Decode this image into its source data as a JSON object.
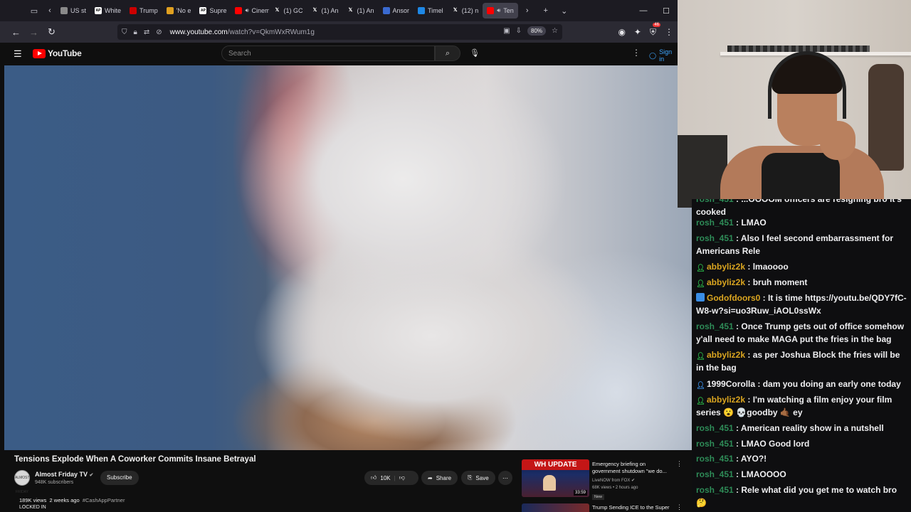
{
  "browser": {
    "tabs": [
      {
        "label": "US st",
        "icon": "doc-icon",
        "color": "#8a8a8a"
      },
      {
        "label": "White",
        "icon": "ap-icon",
        "color": "#ffffff"
      },
      {
        "label": "Trump",
        "icon": "cnn-icon",
        "color": "#cc0000"
      },
      {
        "label": "'No e",
        "icon": "nbc-icon",
        "color": "#e0a020"
      },
      {
        "label": "Supre",
        "icon": "ap-icon",
        "color": "#ffffff"
      },
      {
        "label": "Cinem",
        "icon": "youtube-icon",
        "color": "#ff0000"
      },
      {
        "label": "(1) GC",
        "icon": "x-icon",
        "color": "#ffffff"
      },
      {
        "label": "(1) An",
        "icon": "x-icon",
        "color": "#ffffff"
      },
      {
        "label": "(1) An",
        "icon": "x-icon",
        "color": "#ffffff"
      },
      {
        "label": "Ansor",
        "icon": "site-icon",
        "color": "#3a6ad0"
      },
      {
        "label": "Timel",
        "icon": "globe-icon",
        "color": "#1e88e5"
      },
      {
        "label": "(12) n",
        "icon": "x-icon",
        "color": "#ffffff"
      },
      {
        "label": "Ten",
        "icon": "youtube-icon",
        "color": "#ff0000"
      }
    ],
    "url_host": "www.youtube.com",
    "url_path": "/watch?v=QkmWxRWum1g",
    "zoom": "80%",
    "extension_badge": "46"
  },
  "youtube": {
    "logo_text": "YouTube",
    "search_placeholder": "Search",
    "sign_in": "Sign in",
    "video_title": "Tensions Explode When A Coworker Commits Insane Betrayal",
    "channel_name": "Almost Friday TV",
    "channel_avatar": "ALMOST FRIDAY",
    "subscribers": "948K subscribers",
    "subscribe_label": "Subscribe",
    "likes": "10K",
    "share_label": "Share",
    "save_label": "Save",
    "views": "189K views",
    "age": "2 weeks ago",
    "hashtag": "#CashAppPartner",
    "locked": "LOCKED IN"
  },
  "recommended": [
    {
      "thumb_text": "WH UPDATE",
      "duration": "33:59",
      "title": "Emergency briefing on government shutdown \"we do...",
      "channel": "LiveNOW from FOX",
      "meta": "68K views • 2 hours ago",
      "badge": "New"
    },
    {
      "title": "Trump Sending ICE to the Super"
    }
  ],
  "chat": {
    "messages": [
      {
        "user": "rosh_451",
        "text": " : ...OOOOM officers are resigning bro it's cooked",
        "color": "#2e8b57",
        "icon": ""
      },
      {
        "user": "rosh_451",
        "text": " : LMAO",
        "color": "#2e8b57",
        "icon": ""
      },
      {
        "user": "rosh_451",
        "text": " : Also I feel second embarrassment for Americans Rele",
        "color": "#2e8b57",
        "icon": ""
      },
      {
        "user": "abbyliz2k",
        "text": " : lmaoooo",
        "color": "#daa520",
        "icon": "person-icon"
      },
      {
        "user": "abbyliz2k",
        "text": " : bruh moment",
        "color": "#daa520",
        "icon": "person-icon"
      },
      {
        "user": "Godofdoors0",
        "text": " : It is time https://youtu.be/QDY7fC-W8-w?si=uo3Ruw_iAOL0ssWx",
        "color": "#daa520",
        "icon": "prime-icon"
      },
      {
        "user": "rosh_451",
        "text": " : Once Trump gets out of office somehow y'all need to make MAGA put the fries in the bag",
        "color": "#2e8b57",
        "icon": ""
      },
      {
        "user": "abbyliz2k",
        "text": " : as per Joshua Block the fries will be in the bag",
        "color": "#daa520",
        "icon": "person-icon"
      },
      {
        "user": "1999Corolla",
        "text": " : dam you doing an early one today",
        "color": "#efeff1",
        "icon": "person-blue-icon"
      },
      {
        "user": "abbyliz2k",
        "text": " : I'm watching a film enjoy your film series 😮 💀goodby 🤙🏾 ey",
        "color": "#daa520",
        "icon": "person-icon"
      },
      {
        "user": "rosh_451",
        "text": " : American reality show in a nutshell",
        "color": "#2e8b57",
        "icon": ""
      },
      {
        "user": "rosh_451",
        "text": " : LMAO Good lord",
        "color": "#2e8b57",
        "icon": ""
      },
      {
        "user": "rosh_451",
        "text": " : AYO?!",
        "color": "#2e8b57",
        "icon": ""
      },
      {
        "user": "rosh_451",
        "text": " : LMAOOOO",
        "color": "#2e8b57",
        "icon": ""
      },
      {
        "user": "rosh_451",
        "text": " : Rele what did you get me to watch bro 🤔",
        "color": "#2e8b57",
        "icon": ""
      }
    ]
  }
}
